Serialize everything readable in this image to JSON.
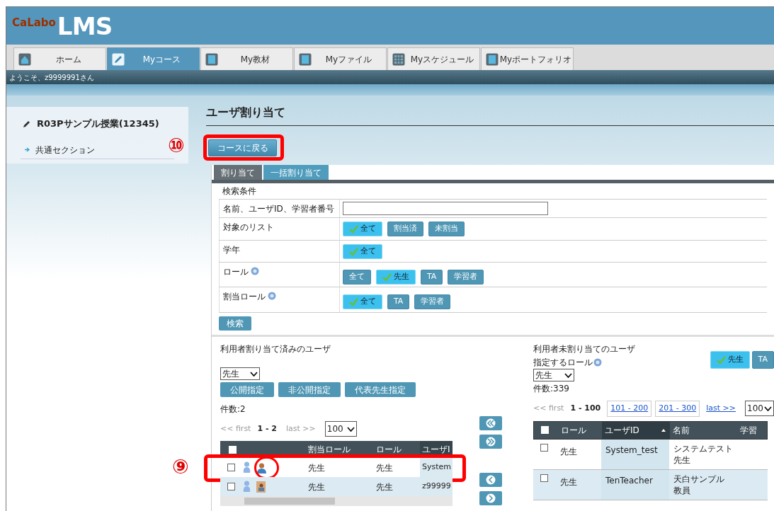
{
  "logo": {
    "brand": "CaLabo",
    "product": "LMS"
  },
  "nav_tabs": [
    {
      "label": "ホーム",
      "selected": false,
      "kind": "home"
    },
    {
      "label": "Myコース",
      "selected": true,
      "kind": "pencil"
    },
    {
      "label": "My教材",
      "selected": false,
      "kind": "book"
    },
    {
      "label": "Myファイル",
      "selected": false,
      "kind": "book"
    },
    {
      "label": "Myスケジュール",
      "selected": false,
      "kind": "calendar"
    },
    {
      "label": "Myポートフォリオ",
      "selected": false,
      "kind": "book"
    }
  ],
  "welcome": "ようこそ、z9999991さん",
  "sidebar": {
    "course": "R03Pサンプル授業(12345)",
    "items": [
      {
        "label": "共通セクション"
      }
    ]
  },
  "page_title": "ユーザ割り当て",
  "back_button": "コースに戻る",
  "callouts": [
    "⑩",
    "⑨"
  ],
  "panel_tabs": [
    {
      "label": "割り当て",
      "selected": true
    },
    {
      "label": "一括割り当て",
      "selected": false
    }
  ],
  "search": {
    "heading": "検索条件",
    "rows": [
      {
        "label": "名前、ユーザID、学習者番号",
        "kind": "text",
        "value": ""
      },
      {
        "label": "対象のリスト",
        "kind": "toggles",
        "options": [
          {
            "label": "全て",
            "selected": true
          },
          {
            "label": "割当済",
            "selected": false
          },
          {
            "label": "未割当",
            "selected": false
          }
        ]
      },
      {
        "label": "学年",
        "kind": "toggles",
        "options": [
          {
            "label": "全て",
            "selected": true
          }
        ]
      },
      {
        "label": "ロール",
        "kind": "toggles",
        "help": true,
        "options": [
          {
            "label": "全て",
            "selected": false
          },
          {
            "label": "先生",
            "selected": true
          },
          {
            "label": "TA",
            "selected": false
          },
          {
            "label": "学習者",
            "selected": false
          }
        ]
      },
      {
        "label": "割当ロール",
        "kind": "toggles",
        "help": true,
        "options": [
          {
            "label": "全て",
            "selected": true
          },
          {
            "label": "TA",
            "selected": false
          },
          {
            "label": "学習者",
            "selected": false
          }
        ]
      }
    ],
    "button": "検索"
  },
  "assigned": {
    "heading": "利用者割り当て済みのユーザ",
    "role_select": "先生",
    "actions": [
      "公開指定",
      "非公開指定",
      "代表先生指定"
    ],
    "count": "件数:2",
    "pager": {
      "first": "<< first",
      "current": "1 - 2",
      "last": "last >>",
      "last_link": false,
      "page_size": "100"
    },
    "all_checked": false,
    "columns": [
      "割当ロール",
      "ロール",
      "ユーザI"
    ],
    "rows": [
      {
        "checked": false,
        "kind": "avatar",
        "assigned_role": "先生",
        "role": "先生",
        "user_id": "System"
      },
      {
        "checked": false,
        "kind": "card",
        "assigned_role": "先生",
        "role": "先生",
        "user_id": "z99999"
      }
    ]
  },
  "unassigned": {
    "heading": "利用者未割り当てのユーザ",
    "role_label": "指定するロール",
    "help": true,
    "role_select": "先生",
    "count": "件数:339",
    "role_toggles": [
      {
        "label": "先生",
        "selected": true
      },
      {
        "label": "TA",
        "selected": false
      }
    ],
    "pager": {
      "first": "<< first",
      "current": "1 - 100",
      "pages": [
        "101 - 200",
        "201 - 300"
      ],
      "last": "last >>",
      "last_link": true,
      "page_size": "100"
    },
    "all_checked": false,
    "columns": [
      {
        "label": "ロール",
        "sorted": false
      },
      {
        "label": "ユーザID",
        "sorted": true
      },
      {
        "label": "名前",
        "sorted": false
      },
      {
        "label": "学習",
        "sorted": false
      }
    ],
    "rows": [
      {
        "checked": false,
        "role": "先生",
        "user_id": "System_test",
        "name": [
          "システムテスト",
          "先生"
        ]
      },
      {
        "checked": false,
        "role": "先生",
        "user_id": "TenTeacher",
        "name": [
          "天白サンプル",
          "教員"
        ]
      }
    ]
  }
}
